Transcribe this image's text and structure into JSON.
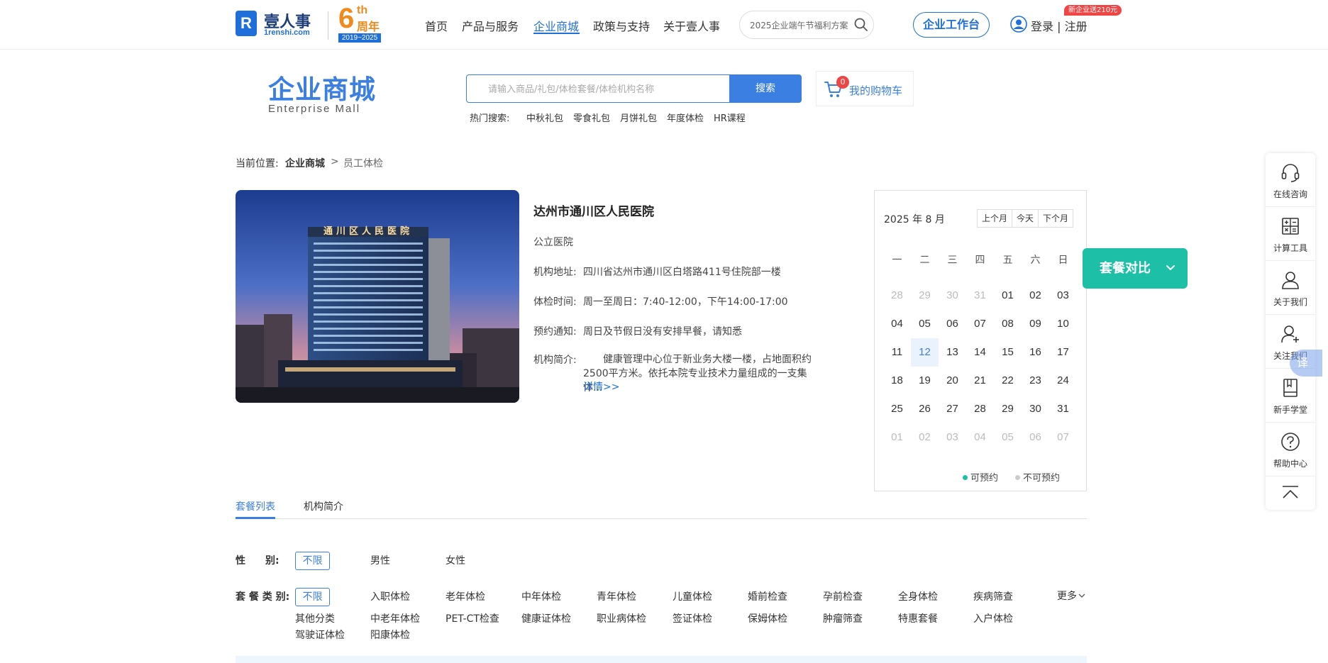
{
  "header": {
    "logo_mark": "R",
    "logo_name": "壹人事",
    "logo_domain": "1renshi.com",
    "anniversary": {
      "number": "6",
      "suffix": "th",
      "label": "周年",
      "years": "2019~2025"
    },
    "nav": [
      {
        "label": "首页"
      },
      {
        "label": "产品与服务"
      },
      {
        "label": "企业商城",
        "active": true
      },
      {
        "label": "政策与支持"
      },
      {
        "label": "关于壹人事"
      }
    ],
    "search_placeholder": "2025企业端午节福利方案",
    "workbench_label": "企业工作台",
    "login_label": "登录 | 注册",
    "promo_badge": "新企业送210元"
  },
  "mall": {
    "title": "企业商城",
    "subtitle": "Enterprise  Mall",
    "search_placeholder": "请输入商品/礼包/体检套餐/体检机构名称",
    "search_button": "搜索",
    "cart_count": "0",
    "cart_label": "我的购物车",
    "hot_label": "热门搜索:",
    "hot_terms": [
      "中秋礼包",
      "零食礼包",
      "月饼礼包",
      "年度体检",
      "HR课程"
    ]
  },
  "breadcrumb": {
    "prefix": "当前位置:",
    "parent": "企业商城",
    "separator": ">",
    "current": "员工体检"
  },
  "hospital": {
    "image_sign": "通川区人民医院",
    "name": "达州市通川区人民医院",
    "type": "公立医院",
    "address_label": "机构地址:",
    "address": "四川省达州市通川区白塔路411号住院部一楼",
    "hours_label": "体检时间:",
    "hours": "周一至周日：7:40-12:00，下午14:00-17:00",
    "notice_label": "预约通知:",
    "notice": "周日及节假日没有安排早餐，请知悉",
    "intro_label": "机构简介:",
    "intro": "健康管理中心位于新业务大楼一楼，占地面积约2500平方米。依托本院专业技术力量组成的一支集体...",
    "more_label": "详情>>"
  },
  "calendar": {
    "title": "2025 年 8 月",
    "buttons": [
      "上个月",
      "今天",
      "下个月"
    ],
    "weekdays": [
      "一",
      "二",
      "三",
      "四",
      "五",
      "六",
      "日"
    ],
    "days": [
      {
        "d": "28",
        "other": true
      },
      {
        "d": "29",
        "other": true
      },
      {
        "d": "30",
        "other": true
      },
      {
        "d": "31",
        "other": true
      },
      {
        "d": "01"
      },
      {
        "d": "02"
      },
      {
        "d": "03"
      },
      {
        "d": "04"
      },
      {
        "d": "05"
      },
      {
        "d": "06"
      },
      {
        "d": "07"
      },
      {
        "d": "08"
      },
      {
        "d": "09"
      },
      {
        "d": "10"
      },
      {
        "d": "11"
      },
      {
        "d": "12",
        "today": true
      },
      {
        "d": "13"
      },
      {
        "d": "14"
      },
      {
        "d": "15"
      },
      {
        "d": "16"
      },
      {
        "d": "17"
      },
      {
        "d": "18"
      },
      {
        "d": "19"
      },
      {
        "d": "20"
      },
      {
        "d": "21"
      },
      {
        "d": "22"
      },
      {
        "d": "23"
      },
      {
        "d": "24"
      },
      {
        "d": "25"
      },
      {
        "d": "26"
      },
      {
        "d": "27"
      },
      {
        "d": "28"
      },
      {
        "d": "29"
      },
      {
        "d": "30"
      },
      {
        "d": "31"
      },
      {
        "d": "01",
        "other": true
      },
      {
        "d": "02",
        "other": true
      },
      {
        "d": "03",
        "other": true
      },
      {
        "d": "04",
        "other": true
      },
      {
        "d": "05",
        "other": true
      },
      {
        "d": "06",
        "other": true
      },
      {
        "d": "07",
        "other": true
      }
    ],
    "legend_available": "可预约",
    "legend_unavailable": "不可预约",
    "available_color": "#1dc0a6",
    "unavailable_color": "#cccccc"
  },
  "compare_button": "套餐对比",
  "tabs": [
    {
      "label": "套餐列表",
      "active": true
    },
    {
      "label": "机构简介"
    }
  ],
  "filters": {
    "gender_label": "性　　别:",
    "gender_options": [
      "不限",
      "男性",
      "女性"
    ],
    "category_label": "套 餐 类 别:",
    "category_row1": [
      "不限",
      "入职体检",
      "老年体检",
      "中年体检",
      "青年体检",
      "儿童体检",
      "婚前检查",
      "孕前检查",
      "全身体检",
      "疾病筛查"
    ],
    "category_row2": [
      "其他分类",
      "中老年体检",
      "PET-CT检查",
      "健康证体检",
      "职业病体检",
      "签证体检",
      "保姆体检",
      "肿瘤筛查",
      "特惠套餐",
      "入户体检"
    ],
    "category_row3": [
      "驾驶证体检",
      "阳康体检"
    ],
    "more_label": "更多"
  },
  "sidebar": {
    "items": [
      {
        "label": "在线咨询",
        "icon": "headset-icon"
      },
      {
        "label": "计算工具",
        "icon": "calculator-icon"
      },
      {
        "label": "关于我们",
        "icon": "user-icon"
      },
      {
        "label": "关注我们",
        "icon": "user-plus-icon"
      },
      {
        "label": "新手学堂",
        "icon": "book-icon"
      },
      {
        "label": "帮助中心",
        "icon": "help-icon"
      }
    ],
    "translate_label": "译"
  },
  "colors": {
    "brand": "#1e6fd9",
    "mall_accent": "#3b7fe3",
    "compare": "#1dc0a6",
    "badge": "#f04545"
  }
}
